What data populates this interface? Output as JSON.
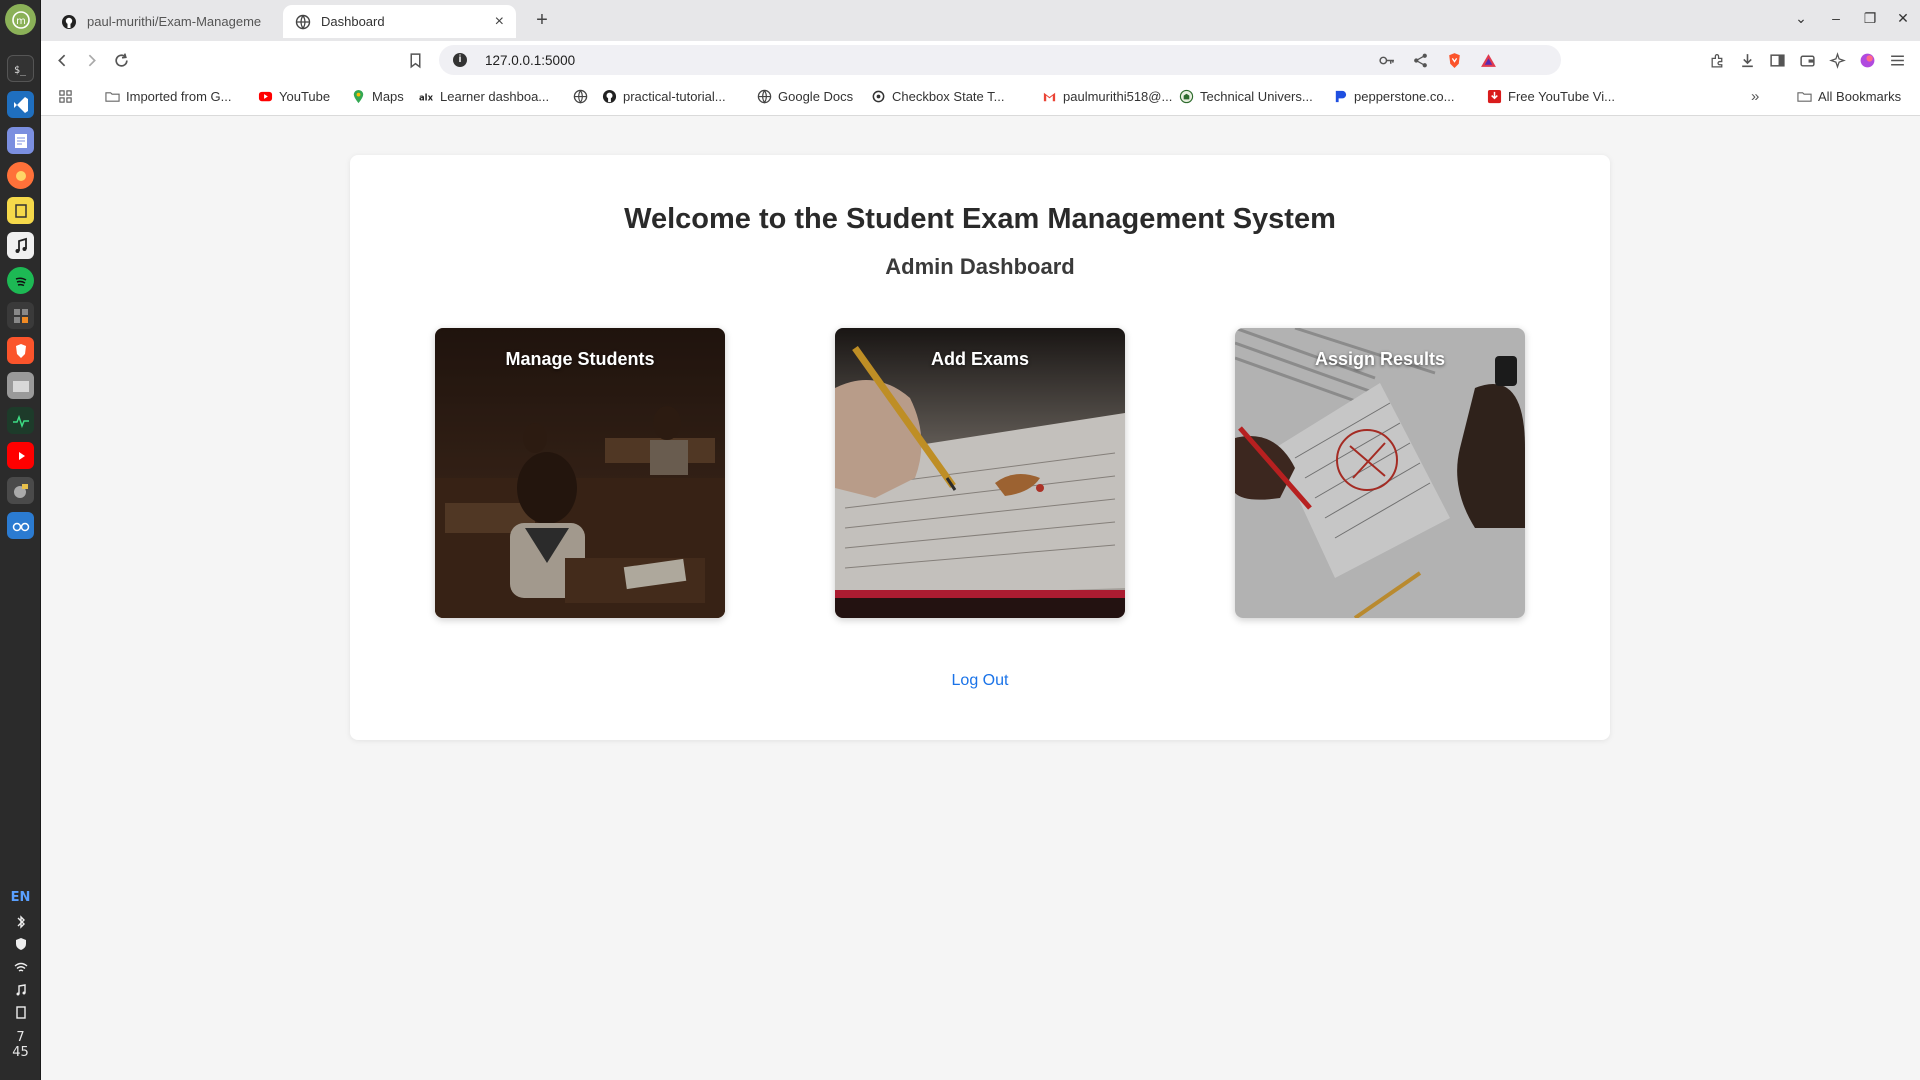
{
  "browser": {
    "tabs": [
      {
        "label": "paul-murithi/Exam-Management"
      },
      {
        "label": "Dashboard",
        "close": "×"
      }
    ],
    "new_tab": "+",
    "url": "127.0.0.1:5000",
    "bookmarks": [
      {
        "label": "Imported from G...",
        "icon": "folder-icon"
      },
      {
        "label": "YouTube",
        "icon": "youtube-icon"
      },
      {
        "label": "Maps",
        "icon": "maps-pin-icon"
      },
      {
        "label": "Learner dashboa...",
        "icon": "alx-icon"
      },
      {
        "label": "",
        "icon": "globe-icon"
      },
      {
        "label": "practical-tutorial...",
        "icon": "github-icon"
      },
      {
        "label": "Google Docs",
        "icon": "globe-icon"
      },
      {
        "label": "Checkbox State T...",
        "icon": "openai-icon"
      },
      {
        "label": "paulmurithi518@...",
        "icon": "gmail-icon"
      },
      {
        "label": "Technical Univers...",
        "icon": "university-icon"
      },
      {
        "label": "pepperstone.co...",
        "icon": "pepperstone-icon"
      },
      {
        "label": "Free YouTube Vi...",
        "icon": "download-icon"
      }
    ],
    "all_bookmarks": "All Bookmarks"
  },
  "dock": {
    "language": "EN",
    "clock_hour": "7",
    "clock_min": "45"
  },
  "dashboard": {
    "title": "Welcome to the Student Exam Management System",
    "subtitle": "Admin Dashboard",
    "features": [
      {
        "label": "Manage Students"
      },
      {
        "label": "Add Exams"
      },
      {
        "label": "Assign Results"
      }
    ],
    "logout": "Log Out"
  },
  "colors": {
    "link": "#1a73e8",
    "brave": "#fb542b"
  }
}
